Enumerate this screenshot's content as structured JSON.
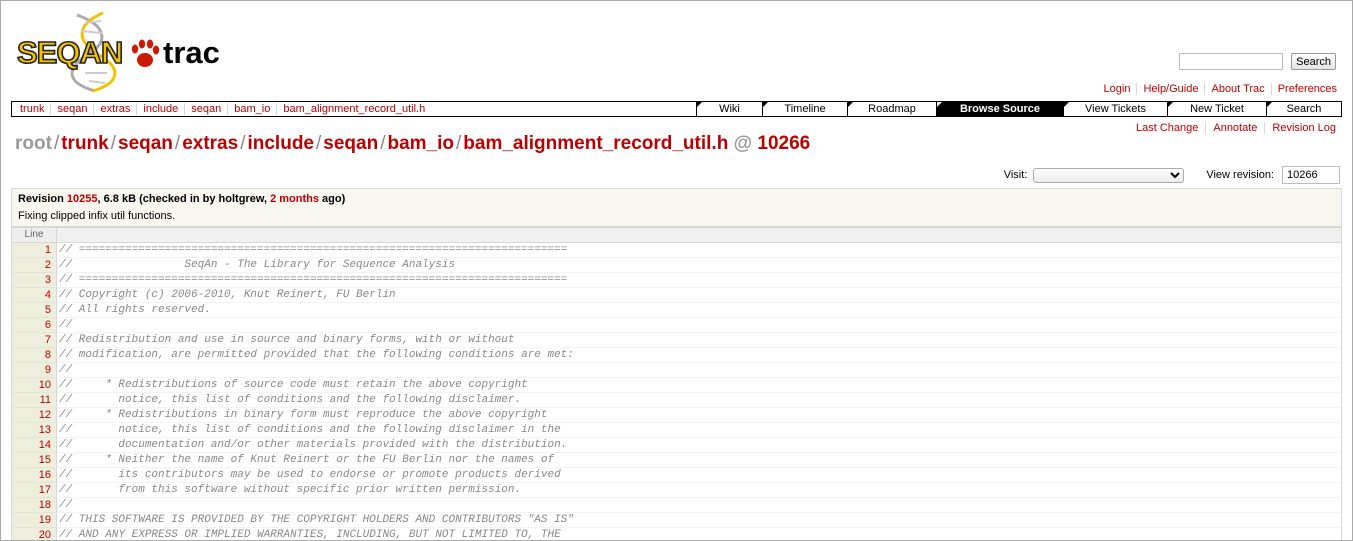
{
  "search": {
    "placeholder": "",
    "button_label": "Search"
  },
  "metanav": [
    {
      "label": "Login"
    },
    {
      "label": "Help/Guide"
    },
    {
      "label": "About Trac"
    },
    {
      "label": "Preferences"
    }
  ],
  "breadcrumbs_nav": [
    {
      "label": "trunk"
    },
    {
      "label": "seqan"
    },
    {
      "label": "extras"
    },
    {
      "label": "include"
    },
    {
      "label": "seqan"
    },
    {
      "label": "bam_io"
    },
    {
      "label": "bam_alignment_record_util.h"
    }
  ],
  "mainnav": [
    {
      "label": "Wiki",
      "width": 66
    },
    {
      "label": "Timeline",
      "width": 85
    },
    {
      "label": "Roadmap",
      "width": 89
    },
    {
      "label": "Browse Source",
      "width": 127,
      "active": true
    },
    {
      "label": "View Tickets",
      "width": 104
    },
    {
      "label": "New Ticket",
      "width": 99
    },
    {
      "label": "Search",
      "width": 75
    }
  ],
  "ctxtnav": [
    {
      "label": "Last Change"
    },
    {
      "label": "Annotate"
    },
    {
      "label": "Revision Log"
    }
  ],
  "path": {
    "root": "root",
    "segments": [
      "trunk",
      "seqan",
      "extras",
      "include",
      "seqan",
      "bam_io",
      "bam_alignment_record_util.h"
    ],
    "at": "@",
    "revision": "10266"
  },
  "visit": {
    "label": "Visit:",
    "selected": "",
    "view_revision_label": "View revision:",
    "view_revision_value": "10266"
  },
  "info": {
    "revision_prefix": "Revision ",
    "revision_link": "10255",
    "revision_mid": ", 6.8 kB (checked in by holtgrew, ",
    "age_link": "2 months",
    "revision_suffix": " ago)",
    "message": "Fixing clipped infix util functions."
  },
  "code": {
    "line_header": "Line",
    "lines": [
      {
        "n": "1",
        "text": "// =========================================================================="
      },
      {
        "n": "2",
        "text": "//                 SeqAn - The Library for Sequence Analysis"
      },
      {
        "n": "3",
        "text": "// =========================================================================="
      },
      {
        "n": "4",
        "text": "// Copyright (c) 2006-2010, Knut Reinert, FU Berlin"
      },
      {
        "n": "5",
        "text": "// All rights reserved."
      },
      {
        "n": "6",
        "text": "//"
      },
      {
        "n": "7",
        "text": "// Redistribution and use in source and binary forms, with or without"
      },
      {
        "n": "8",
        "text": "// modification, are permitted provided that the following conditions are met:"
      },
      {
        "n": "9",
        "text": "//"
      },
      {
        "n": "10",
        "text": "//     * Redistributions of source code must retain the above copyright"
      },
      {
        "n": "11",
        "text": "//       notice, this list of conditions and the following disclaimer."
      },
      {
        "n": "12",
        "text": "//     * Redistributions in binary form must reproduce the above copyright"
      },
      {
        "n": "13",
        "text": "//       notice, this list of conditions and the following disclaimer in the"
      },
      {
        "n": "14",
        "text": "//       documentation and/or other materials provided with the distribution."
      },
      {
        "n": "15",
        "text": "//     * Neither the name of Knut Reinert or the FU Berlin nor the names of"
      },
      {
        "n": "16",
        "text": "//       its contributors may be used to endorse or promote products derived"
      },
      {
        "n": "17",
        "text": "//       from this software without specific prior written permission."
      },
      {
        "n": "18",
        "text": "//"
      },
      {
        "n": "19",
        "text": "// THIS SOFTWARE IS PROVIDED BY THE COPYRIGHT HOLDERS AND CONTRIBUTORS \"AS IS\""
      },
      {
        "n": "20",
        "text": "// AND ANY EXPRESS OR IMPLIED WARRANTIES, INCLUDING, BUT NOT LIMITED TO, THE"
      }
    ]
  },
  "logo": {
    "name": "SeqAn trac",
    "colors": {
      "seqan": "#f2c200",
      "outline": "#222",
      "trac": "#000",
      "paw": "#cc1a00"
    }
  }
}
